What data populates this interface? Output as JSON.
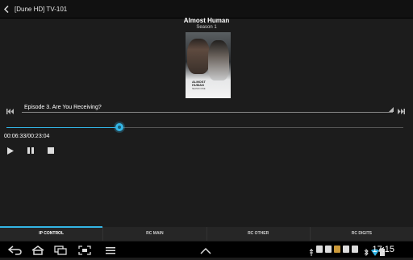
{
  "header": {
    "title": "[Dune HD] TV-101"
  },
  "media": {
    "show_title": "Almost Human",
    "season": "Season 1",
    "poster_title": "ALMOST HUMAN",
    "poster_subtitle": "SEASON ONE"
  },
  "episode": {
    "title": "Episode 3. Are You Receiving?"
  },
  "playback": {
    "time": "00:06:33/00:23:04",
    "progress": 0.284
  },
  "tabs": [
    {
      "label": "IP CONTROL",
      "active": true
    },
    {
      "label": "RC MAIN",
      "active": false
    },
    {
      "label": "RC OTHER",
      "active": false
    },
    {
      "label": "RC DIGITS",
      "active": false
    }
  ],
  "statusbar": {
    "time": "17:15"
  },
  "colors": {
    "accent": "#33b5e5",
    "background": "#1c1c1c"
  }
}
